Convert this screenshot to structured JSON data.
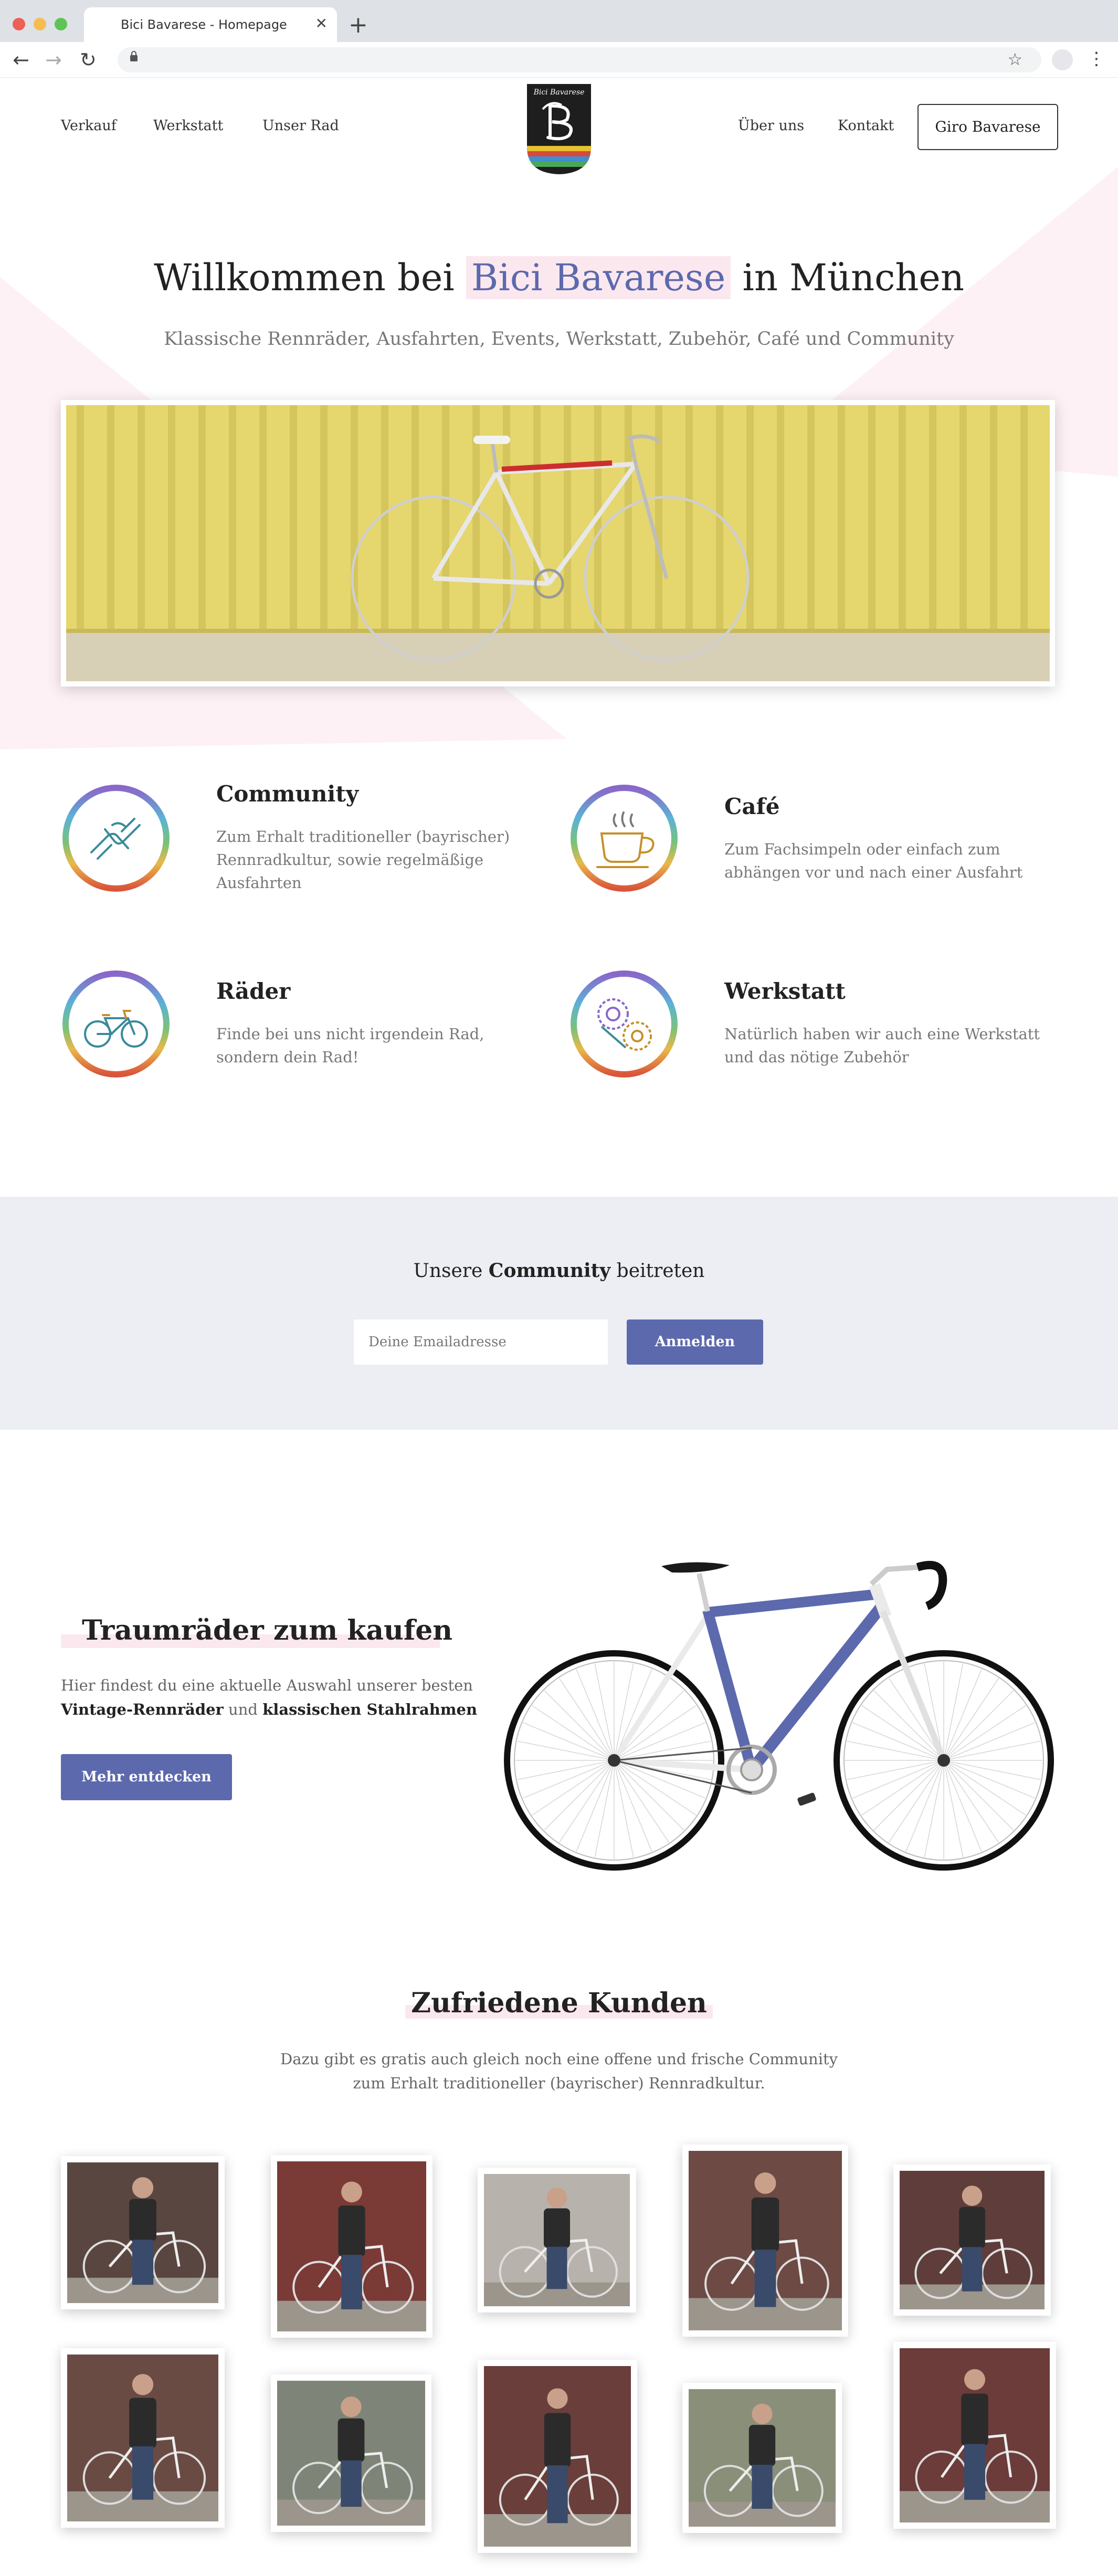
{
  "browser": {
    "tab_title": "Bici Bavarese - Homepage",
    "tab_close": "✕",
    "new_tab": "+",
    "back": "←",
    "forward": "→",
    "reload": "↻",
    "bookmark": "☆",
    "menu": "⋮"
  },
  "nav": {
    "left": [
      "Verkauf",
      "Werkstatt",
      "Unser Rad"
    ],
    "right": [
      "Über uns",
      "Kontakt"
    ],
    "cta": "Giro Bavarese",
    "logo_text": "Bici Bavarese"
  },
  "hero": {
    "title_pre": "Willkommen bei ",
    "title_brand": "Bici Bavarese",
    "title_post": " in München",
    "subtitle": "Klassische Rennräder, Ausfahrten, Events, Werkstatt,  Zubehör, Café und Community"
  },
  "features": [
    {
      "icon": "handshake-icon",
      "title": "Community",
      "text": "Zum Erhalt traditioneller (bayrischer) Rennradkultur, sowie regelmäßige Ausfahrten"
    },
    {
      "icon": "coffee-cup-icon",
      "title": "Café",
      "text": "Zum Fachsimpeln oder einfach zum abhängen vor und nach einer Ausfahrt"
    },
    {
      "icon": "bicycle-icon",
      "title": "Räder",
      "text": "Finde bei uns nicht irgendein Rad, sondern dein Rad!"
    },
    {
      "icon": "gears-icon",
      "title": "Werkstatt",
      "text": "Natürlich haben wir auch eine Werkstatt und das nötige Zubehör"
    }
  ],
  "newsletter": {
    "title_pre": "Unsere ",
    "title_bold": "Community",
    "title_post": " beitreten",
    "placeholder": "Deine Emailadresse",
    "button": "Anmelden"
  },
  "traumraeder": {
    "title": "Traumräder zum kaufen",
    "text_pre": "Hier findest du eine aktuelle Auswahl unserer besten ",
    "bold1": "Vintage-Rennräder",
    "text_mid": " und ",
    "bold2": "klassischen Stahlrahmen",
    "button": "Mehr entdecken"
  },
  "kunden": {
    "title": "Zufriedene Kunden",
    "text_line1": "Dazu gibt es gratis auch gleich noch eine offene und frische Community",
    "text_line2": "zum Erhalt traditioneller (bayrischer) Rennradkultur."
  },
  "colors": {
    "accent": "#5c69ad",
    "highlight": "#fbe8ef",
    "bike_frame": "#5c69ad",
    "hero_wall": "#e3d56c"
  }
}
